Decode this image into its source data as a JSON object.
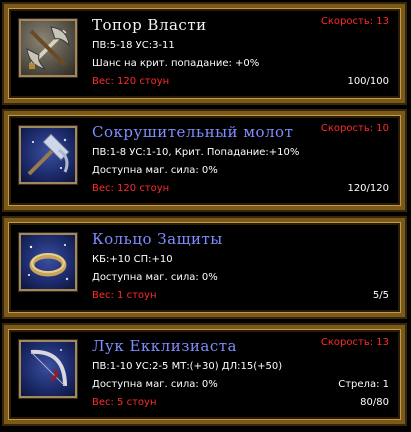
{
  "items": [
    {
      "title": "Топор Власти",
      "speed": "Скорость: 13",
      "line1": "ПВ:5-18  УС:3-11",
      "line2": "Шанс на крит. попадание: +0%",
      "weight": "Вес: 120 стоун",
      "durability": "100/100",
      "icon": "crossed-axe-sword-icon"
    },
    {
      "title": "Сокрушительный молот",
      "speed": "Скорость: 10",
      "line1": "ПВ:1-8 УС:1-10, Крит. Попадание:+10%",
      "line2": "Доступна маг. сила: 0%",
      "weight": "Вес: 120 стоун",
      "durability": "120/120",
      "icon": "hammer-icon"
    },
    {
      "title": "Кольцо Защиты",
      "speed": "",
      "line1": "КБ:+10 СП:+10",
      "line2": "Доступна маг. сила: 0%",
      "weight": "Вес: 1 стоун",
      "durability": "5/5",
      "icon": "ring-icon"
    },
    {
      "title": "Лук Екклизиаста",
      "speed": "Скорость: 13",
      "line1": "ПВ:1-10  УС:2-5  МТ:(+30)  ДЛ:15(+50)",
      "line2": "Доступна маг. сила: 0%",
      "extra": "Стрела: 1",
      "weight": "Вес: 5 стоун",
      "durability": "80/80",
      "icon": "bow-icon"
    }
  ],
  "colors": {
    "frame": "#7a5a1c",
    "title_white": "#f2f2f2",
    "title_blue": "#7f8dff",
    "red": "#ff2b2b"
  }
}
